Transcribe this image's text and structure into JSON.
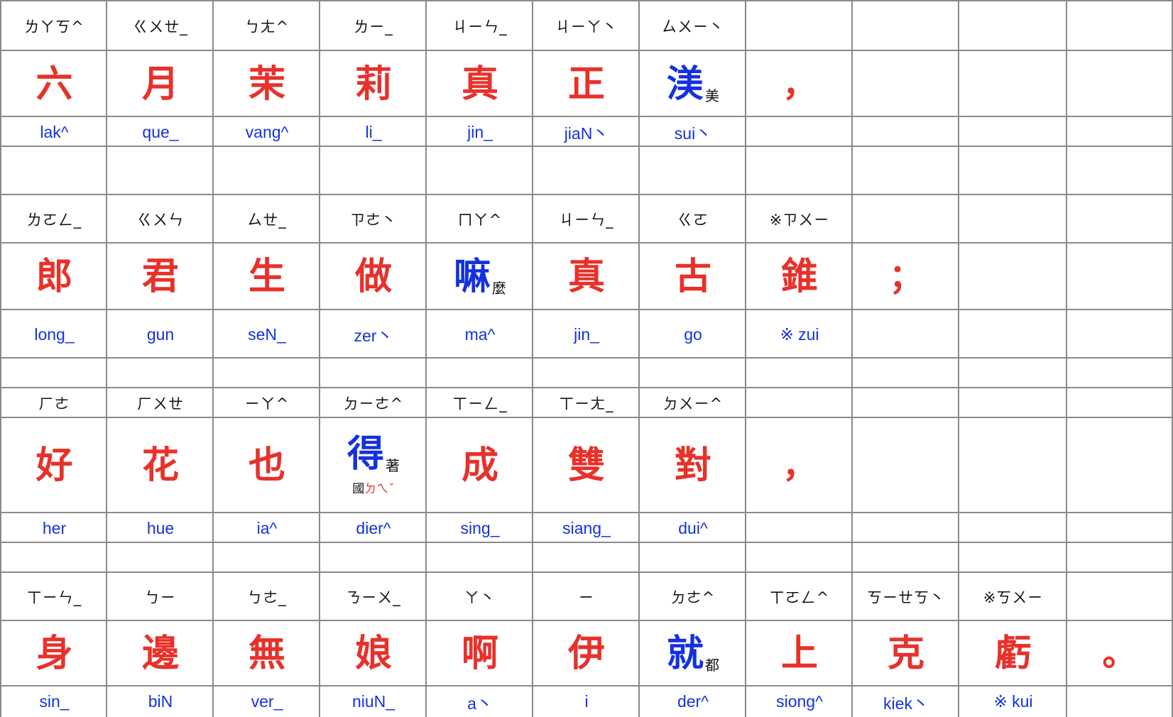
{
  "verses": [
    {
      "cells": [
        {
          "bopomofo": "ㄌㄚㄎ^",
          "han": "六",
          "han_color": "red",
          "romanization": "lak^"
        },
        {
          "bopomofo": "ㄍㄨㄝ_",
          "han": "月",
          "han_color": "red",
          "romanization": "que_"
        },
        {
          "bopomofo": "ㄅㄤ^",
          "han": "茉",
          "han_color": "red",
          "romanization": "vang^"
        },
        {
          "bopomofo": "ㄌㄧ_",
          "han": "莉",
          "han_color": "red",
          "romanization": "li_"
        },
        {
          "bopomofo": "ㄐㄧㄣ_",
          "han": "真",
          "han_color": "red",
          "romanization": "jin_"
        },
        {
          "bopomofo": "ㄐㄧㄚ丶",
          "han": "正",
          "han_color": "red",
          "romanization": "jiaN丶"
        },
        {
          "bopomofo": "ㄙㄨㄧ丶",
          "han": "渼",
          "han_color": "blue",
          "gloss": "美",
          "romanization": "sui丶"
        },
        {
          "han": "，",
          "punct": true
        },
        {},
        {},
        {}
      ]
    },
    {
      "cells": [
        {
          "bopomofo": "ㄌㄛㄥ_",
          "han": "郎",
          "han_color": "red",
          "romanization": "long_"
        },
        {
          "bopomofo": "ㄍㄨㄣ",
          "han": "君",
          "han_color": "red",
          "romanization": "gun"
        },
        {
          "bopomofo": "ㄙㄝ_",
          "han": "生",
          "han_color": "red",
          "romanization": "seN_"
        },
        {
          "bopomofo": "ㄗㄜ丶",
          "han": "做",
          "han_color": "red",
          "romanization": "zer丶"
        },
        {
          "bopomofo": "ㄇㄚ^",
          "han": "嘛",
          "han_color": "blue",
          "gloss": "麼",
          "romanization": "ma^"
        },
        {
          "bopomofo": "ㄐㄧㄣ_",
          "han": "真",
          "han_color": "red",
          "romanization": "jin_"
        },
        {
          "bopomofo": "ㄍㄛ",
          "han": "古",
          "han_color": "red",
          "romanization": "go"
        },
        {
          "bopomofo": "※ㄗㄨㄧ",
          "han": "錐",
          "han_color": "red",
          "romanization": "※ zui"
        },
        {
          "han": "；",
          "punct": true
        },
        {},
        {}
      ]
    },
    {
      "cells": [
        {
          "bopomofo": "ㄏㄜ",
          "han": "好",
          "han_color": "red",
          "romanization": "her"
        },
        {
          "bopomofo": "ㄏㄨㄝ",
          "han": "花",
          "han_color": "red",
          "romanization": "hue"
        },
        {
          "bopomofo": "ㄧㄚ^",
          "han": "也",
          "han_color": "red",
          "romanization": "ia^"
        },
        {
          "bopomofo": "ㄉㄧㄜ^",
          "han": "得",
          "han_color": "blue",
          "gloss": "著",
          "note_label": "國",
          "note_bopomofo": "ㄉㄟˇ",
          "romanization": "dier^"
        },
        {
          "bopomofo": "ㄒㄧㄥ_",
          "han": "成",
          "han_color": "red",
          "romanization": "sing_"
        },
        {
          "bopomofo": "ㄒㄧㄤ_",
          "han": "雙",
          "han_color": "red",
          "romanization": "siang_"
        },
        {
          "bopomofo": "ㄉㄨㄧ^",
          "han": "對",
          "han_color": "red",
          "romanization": "dui^"
        },
        {
          "han": "，",
          "punct": true
        },
        {},
        {},
        {}
      ]
    },
    {
      "cells": [
        {
          "bopomofo": "ㄒㄧㄣ_",
          "han": "身",
          "han_color": "red",
          "romanization": "sin_"
        },
        {
          "bopomofo": "ㄅㄧ",
          "han": "邊",
          "han_color": "red",
          "romanization": "biN"
        },
        {
          "bopomofo": "ㄅㄜ_",
          "han": "無",
          "han_color": "red",
          "romanization": "ver_"
        },
        {
          "bopomofo": "ㄋㄧㄨ_",
          "han": "娘",
          "han_color": "red",
          "romanization": "niuN_"
        },
        {
          "bopomofo": "ㄚ丶",
          "han": "啊",
          "han_color": "red",
          "romanization": "a丶"
        },
        {
          "bopomofo": "ㄧ",
          "han": "伊",
          "han_color": "red",
          "romanization": "i"
        },
        {
          "bopomofo": "ㄉㄜ^",
          "han": "就",
          "han_color": "blue",
          "gloss": "都",
          "romanization": "der^"
        },
        {
          "bopomofo": "ㄒㄛㄥ^",
          "han": "上",
          "han_color": "red",
          "romanization": "siong^"
        },
        {
          "bopomofo": "ㄎㄧㄝㄎ丶",
          "han": "克",
          "han_color": "red",
          "romanization": "kiek丶"
        },
        {
          "bopomofo": "※ㄎㄨㄧ",
          "han": "虧",
          "han_color": "red",
          "romanization": "※ kui"
        },
        {
          "han": "。",
          "punct": true
        }
      ]
    }
  ]
}
